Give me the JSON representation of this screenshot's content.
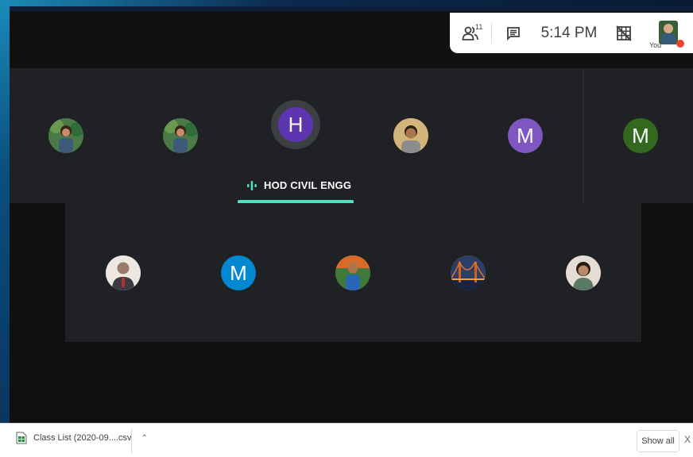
{
  "topbar": {
    "participants_count": "11",
    "time": "5:14 PM",
    "you_label": "You"
  },
  "tiles_row1": [
    {
      "kind": "photo",
      "color": "#4a7a45"
    },
    {
      "kind": "photo",
      "color": "#4a7a45"
    },
    {
      "kind": "letter",
      "letter": "H",
      "color": "#5e35b1",
      "speaking": true
    },
    {
      "kind": "photo",
      "color": "#c8a46a"
    },
    {
      "kind": "letter",
      "letter": "M",
      "color": "#7e57c2"
    },
    {
      "kind": "letter",
      "letter": "M",
      "color": "#33691e"
    }
  ],
  "speaker": {
    "name": "HOD CIVIL ENGG"
  },
  "tiles_row2": [
    {
      "kind": "photo",
      "color": "#c9b7a3"
    },
    {
      "kind": "letter",
      "letter": "M",
      "color": "#0288d1"
    },
    {
      "kind": "photo",
      "color": "#c4561c"
    },
    {
      "kind": "photo",
      "color": "#c86a1c"
    },
    {
      "kind": "photo",
      "color": "#a89080"
    }
  ],
  "download_bar": {
    "file_name": "Class List (2020-09....csv",
    "show_all": "Show all",
    "close": "X"
  }
}
